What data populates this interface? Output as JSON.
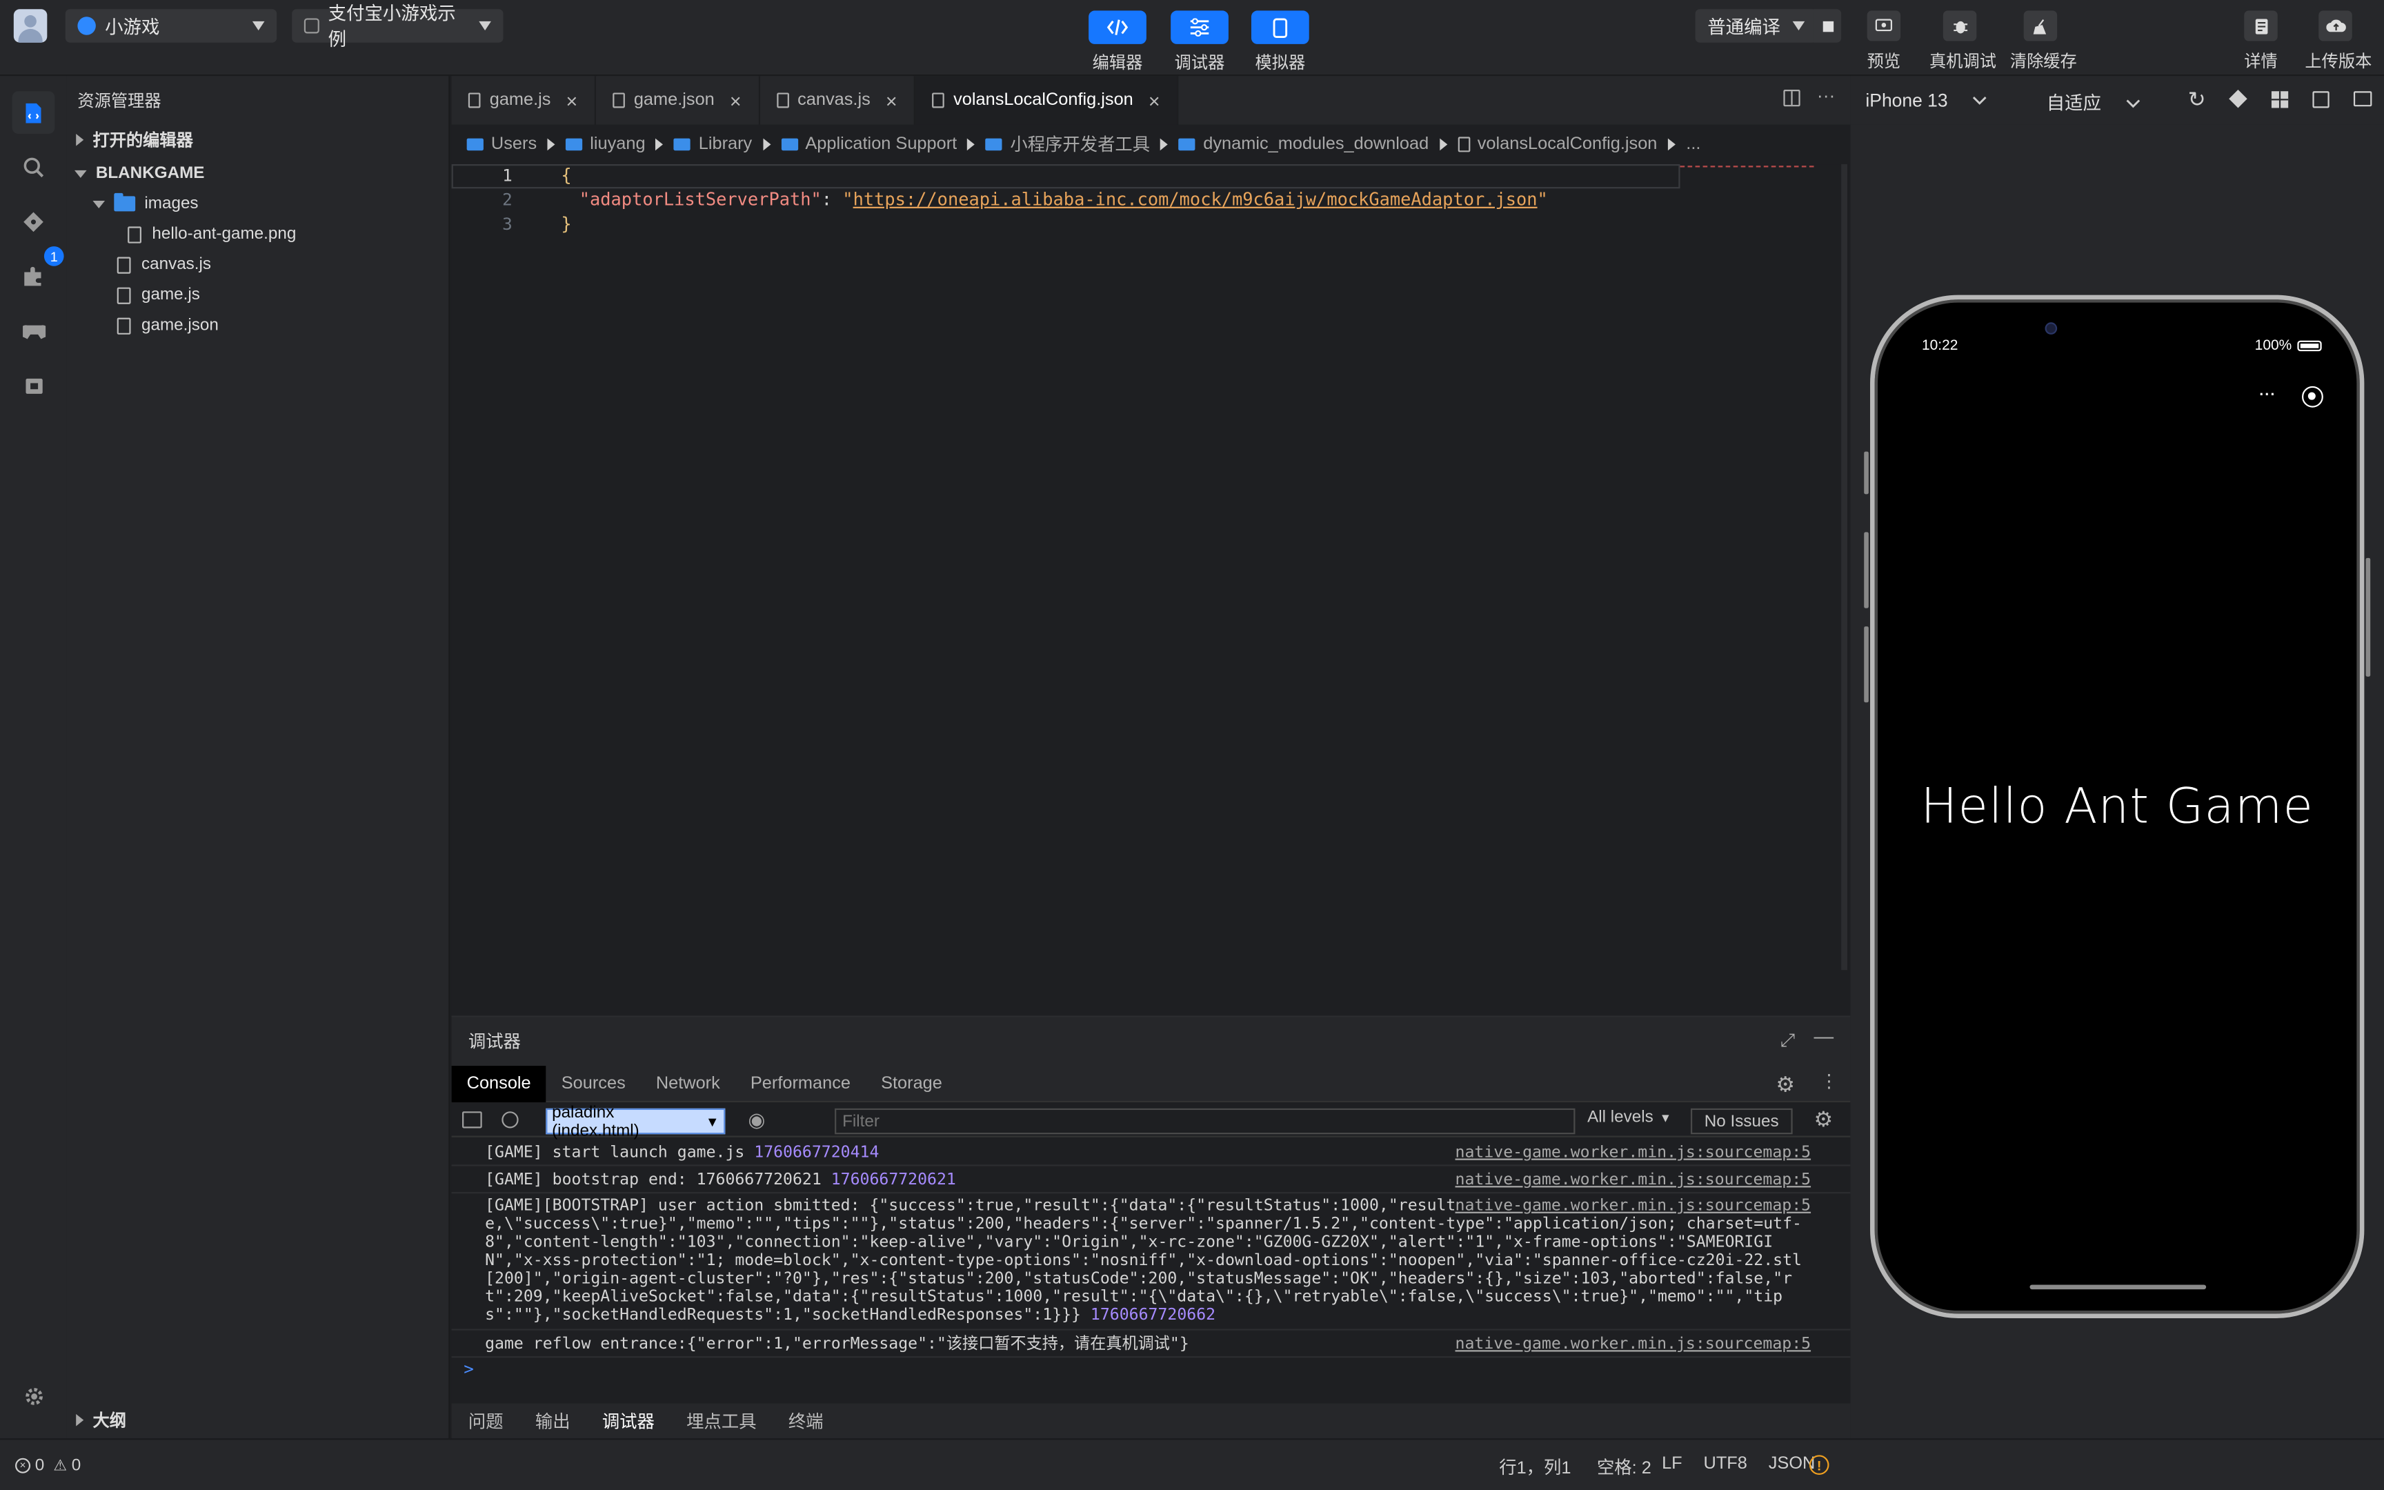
{
  "topbar": {
    "project_type": "小游戏",
    "project_name": "支付宝小游戏示例",
    "modes": [
      {
        "label": "编辑器",
        "icon": "code-icon"
      },
      {
        "label": "调试器",
        "icon": "sliders-icon"
      },
      {
        "label": "模拟器",
        "icon": "phone-icon"
      }
    ],
    "compile_mode": "普通编译",
    "actions": [
      {
        "label": "预览",
        "icon": "preview-icon"
      },
      {
        "label": "真机调试",
        "icon": "bug-icon"
      },
      {
        "label": "清除缓存",
        "icon": "broom-icon"
      }
    ],
    "right_actions": [
      {
        "label": "详情",
        "icon": "details-icon"
      },
      {
        "label": "上传版本",
        "icon": "upload-icon"
      }
    ]
  },
  "activity": {
    "extensions_badge": "1"
  },
  "explorer": {
    "title": "资源管理器",
    "open_editors": "打开的编辑器",
    "root": "BLANKGAME",
    "tree": [
      {
        "label": "images",
        "type": "folder"
      },
      {
        "label": "hello-ant-game.png",
        "type": "file"
      },
      {
        "label": "canvas.js",
        "type": "file"
      },
      {
        "label": "game.js",
        "type": "file"
      },
      {
        "label": "game.json",
        "type": "file"
      }
    ],
    "outline": "大纲"
  },
  "editor": {
    "tabs": [
      {
        "label": "game.js"
      },
      {
        "label": "game.json"
      },
      {
        "label": "canvas.js"
      },
      {
        "label": "volansLocalConfig.json"
      }
    ],
    "breadcrumb": [
      "Users",
      "liuyang",
      "Library",
      "Application Support",
      "小程序开发者工具",
      "dynamic_modules_download",
      "volansLocalConfig.json",
      "..."
    ],
    "line_numbers": [
      "1",
      "2",
      "3"
    ],
    "code": {
      "open_brace": "{",
      "key": "\"adaptorListServerPath\"",
      "colon": ": ",
      "q1": "\"",
      "url": "https://oneapi.alibaba-inc.com/mock/m9c6aijw/mockGameAdaptor.json",
      "q2": "\"",
      "close_brace": "}"
    }
  },
  "debugger": {
    "title": "调试器",
    "tabs": [
      "Console",
      "Sources",
      "Network",
      "Performance",
      "Storage"
    ],
    "context": "paladinx (index.html)",
    "filter_placeholder": "Filter",
    "levels": "All levels",
    "issues": "No Issues",
    "logs": [
      {
        "text": "[GAME] start launch game.js ",
        "ts": "1760667720414",
        "src": "native-game.worker.min.js:sourcemap:5"
      },
      {
        "text": "[GAME] bootstrap end: 1760667720621 ",
        "ts": "1760667720621",
        "src": "native-game.worker.min.js:sourcemap:5"
      },
      {
        "text": "[GAME][BOOTSTRAP] user action sbmitted: {\"success\":true,\"result\":{\"data\":{\"resultStatus\":1000,\"result\":\"{\\\"data\\\":{},\\\"retryable\\\":false,\\\"success\\\":true}\",\"memo\":\"\",\"tips\":\"\"},\"status\":200,\"headers\":{\"server\":\"spanner/1.5.2\",\"content-type\":\"application/json; charset=utf-8\",\"content-length\":\"103\",\"connection\":\"keep-alive\",\"vary\":\"Origin\",\"x-rc-zone\":\"GZ00G-GZ20X\",\"alert\":\"1\",\"x-frame-options\":\"SAMEORIGIN\",\"x-xss-protection\":\"1; mode=block\",\"x-content-type-options\":\"nosniff\",\"x-download-options\":\"noopen\",\"via\":\"spanner-office-cz20i-22.stl[200]\",\"origin-agent-cluster\":\"?0\"},\"res\":{\"status\":200,\"statusCode\":200,\"statusMessage\":\"OK\",\"headers\":{},\"size\":103,\"aborted\":false,\"rt\":209,\"keepAliveSocket\":false,\"data\":{\"resultStatus\":1000,\"result\":\"{\\\"data\\\":{},\\\"retryable\\\":false,\\\"success\\\":true}\",\"memo\":\"\",\"tips\":\"\"},\"socketHandledRequests\":1,\"socketHandledResponses\":1}}} ",
        "ts": "1760667720662",
        "src": "native-game.worker.min.js:sourcemap:5"
      },
      {
        "text": "game reflow entrance:{\"error\":1,\"errorMessage\":\"该接口暂不支持，请在真机调试\"}",
        "ts": "",
        "src": "native-game.worker.min.js:sourcemap:5"
      }
    ],
    "prompt": ">",
    "bottom_tabs": [
      "问题",
      "输出",
      "调试器",
      "埋点工具",
      "终端"
    ]
  },
  "simulator": {
    "device": "iPhone 13",
    "scale": "自适应",
    "time": "10:22",
    "battery": "100%",
    "content_text": "Hello Ant Game"
  },
  "statusbar": {
    "errors": "0",
    "warnings": "0",
    "position": "行1，列1",
    "spaces": "空格: 2",
    "eol": "LF",
    "encoding": "UTF8",
    "language": "JSON"
  },
  "colors": {
    "accent": "#1677ff",
    "json_key": "#f28b82",
    "json_string": "#e8a45b",
    "timestamp": "#a68bff"
  }
}
